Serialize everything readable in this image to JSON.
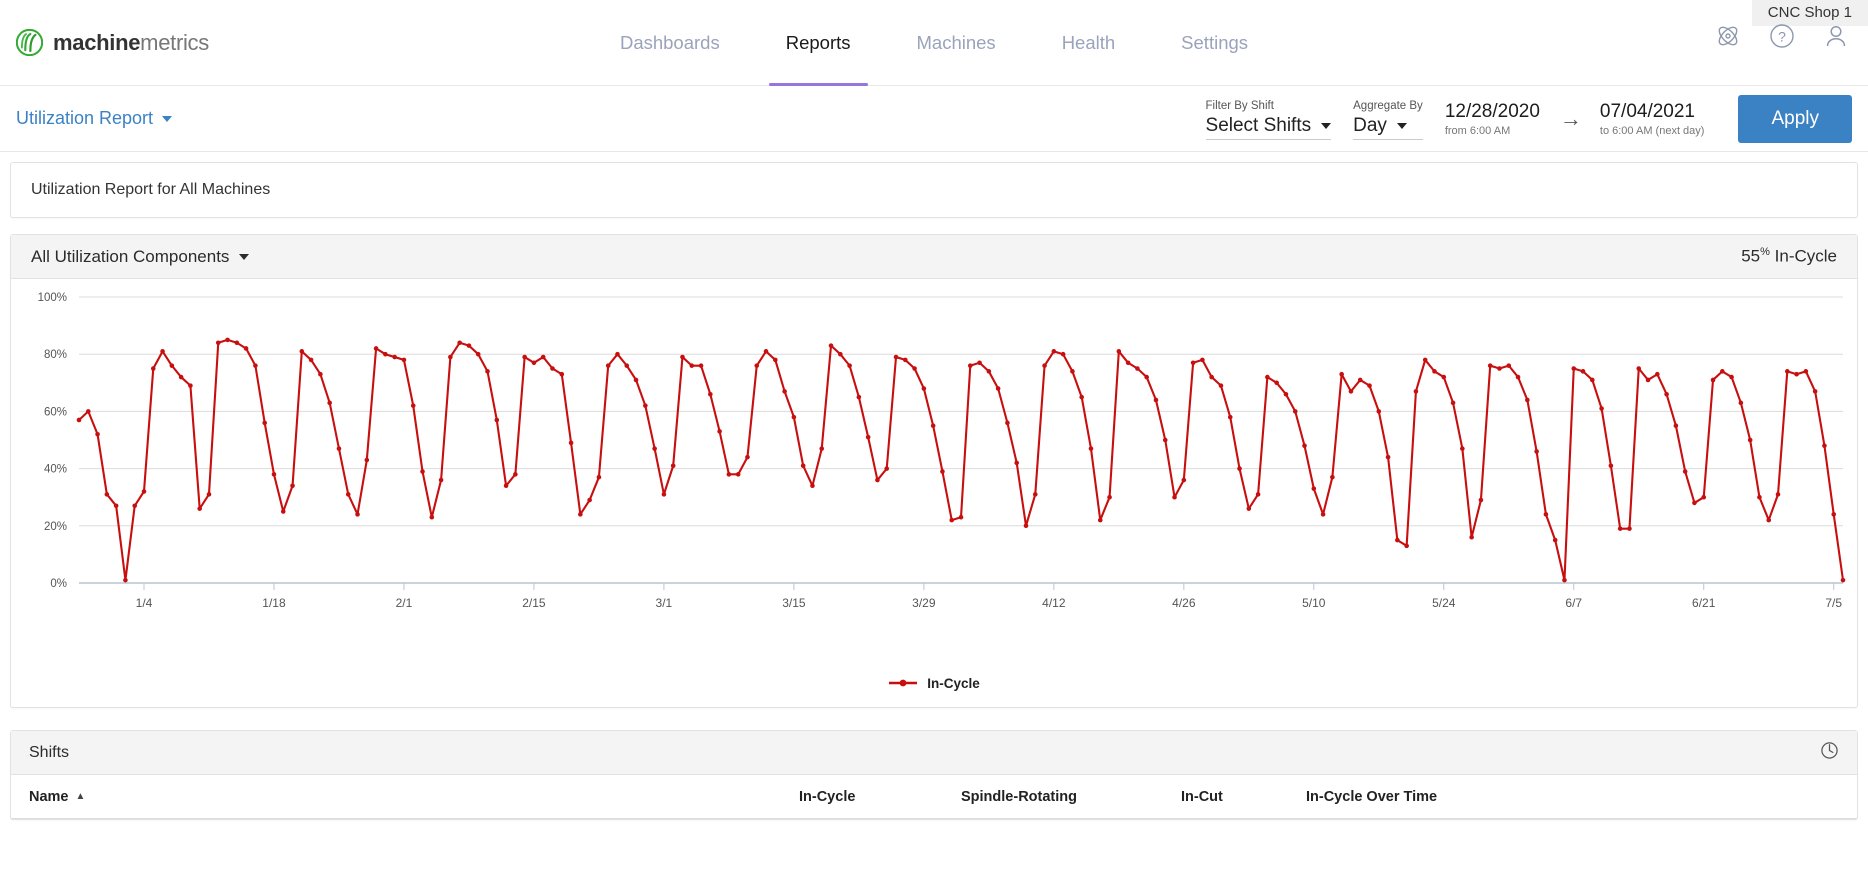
{
  "header": {
    "shop_chip": "CNC Shop 1",
    "brand_bold": "machine",
    "brand_light": "metrics",
    "nav": [
      {
        "label": "Dashboards",
        "active": false
      },
      {
        "label": "Reports",
        "active": true
      },
      {
        "label": "Machines",
        "active": false
      },
      {
        "label": "Health",
        "active": false
      },
      {
        "label": "Settings",
        "active": false
      }
    ],
    "icons": [
      {
        "name": "atom-icon"
      },
      {
        "name": "help-circle-icon"
      },
      {
        "name": "user-account-icon"
      }
    ]
  },
  "filterbar": {
    "report_name": "Utilization Report",
    "shift_label": "Filter By Shift",
    "shift_value": "Select Shifts",
    "aggregate_label": "Aggregate By",
    "aggregate_value": "Day",
    "start_date": "12/28/2020",
    "start_sub": "from 6:00 AM",
    "end_date": "07/04/2021",
    "end_sub": "to 6:00 AM (next day)",
    "range_arrow": "→",
    "apply_label": "Apply"
  },
  "report_title": "Utilization Report for All Machines",
  "chart_panel": {
    "selector_label": "All Utilization Components",
    "summary_value": "55",
    "summary_unit": "%",
    "summary_label": " In-Cycle"
  },
  "shifts_panel": {
    "title": "Shifts",
    "columns": [
      {
        "label": "Name",
        "sort": "▲"
      },
      {
        "label": "In-Cycle"
      },
      {
        "label": "Spindle-Rotating"
      },
      {
        "label": "In-Cut"
      },
      {
        "label": "In-Cycle Over Time"
      }
    ]
  },
  "colors": {
    "accent_blue": "#3b82c4",
    "series_red": "#c80f0f",
    "brand_green": "#35aa34",
    "tab_underline": "#9575e0"
  },
  "chart_data": {
    "type": "line",
    "title": "",
    "xlabel": "",
    "ylabel": "",
    "ylim": [
      0,
      100
    ],
    "ytick_labels": [
      "0%",
      "20%",
      "40%",
      "60%",
      "80%",
      "100%"
    ],
    "yticks": [
      0,
      20,
      40,
      60,
      80,
      100
    ],
    "grid": true,
    "legend": [
      "In-Cycle"
    ],
    "legend_position": "bottom-center",
    "x_start": "12/28/2020",
    "x_end": "7/5",
    "xtick_labels": [
      "1/4",
      "1/18",
      "2/1",
      "2/15",
      "3/1",
      "3/15",
      "3/29",
      "4/12",
      "4/26",
      "5/10",
      "5/24",
      "6/7",
      "6/21",
      "7/5"
    ],
    "xtick_indices": [
      7,
      21,
      35,
      49,
      63,
      77,
      91,
      105,
      119,
      133,
      147,
      161,
      175,
      189
    ],
    "series": [
      {
        "name": "In-Cycle",
        "color": "#c80f0f",
        "values": [
          57,
          60,
          52,
          31,
          27,
          1,
          27,
          32,
          75,
          81,
          76,
          72,
          69,
          26,
          31,
          84,
          85,
          84,
          82,
          76,
          56,
          38,
          25,
          34,
          81,
          78,
          73,
          63,
          47,
          31,
          24,
          43,
          82,
          80,
          79,
          78,
          62,
          39,
          23,
          36,
          79,
          84,
          83,
          80,
          74,
          57,
          34,
          38,
          79,
          77,
          79,
          75,
          73,
          49,
          24,
          29,
          37,
          76,
          80,
          76,
          71,
          62,
          47,
          31,
          41,
          79,
          76,
          76,
          66,
          53,
          38,
          38,
          44,
          76,
          81,
          78,
          67,
          58,
          41,
          34,
          47,
          83,
          80,
          76,
          65,
          51,
          36,
          40,
          79,
          78,
          75,
          68,
          55,
          39,
          22,
          23,
          76,
          77,
          74,
          68,
          56,
          42,
          20,
          31,
          76,
          81,
          80,
          74,
          65,
          47,
          22,
          30,
          81,
          77,
          75,
          72,
          64,
          50,
          30,
          36,
          77,
          78,
          72,
          69,
          58,
          40,
          26,
          31,
          72,
          70,
          66,
          60,
          48,
          33,
          24,
          37,
          73,
          67,
          71,
          69,
          60,
          44,
          15,
          13,
          67,
          78,
          74,
          72,
          63,
          47,
          16,
          29,
          76,
          75,
          76,
          72,
          64,
          46,
          24,
          15,
          1,
          75,
          74,
          71,
          61,
          41,
          19,
          19,
          75,
          71,
          73,
          66,
          55,
          39,
          28,
          30,
          71,
          74,
          72,
          63,
          50,
          30,
          22,
          31,
          74,
          73,
          74,
          67,
          48,
          24,
          1
        ]
      }
    ]
  }
}
